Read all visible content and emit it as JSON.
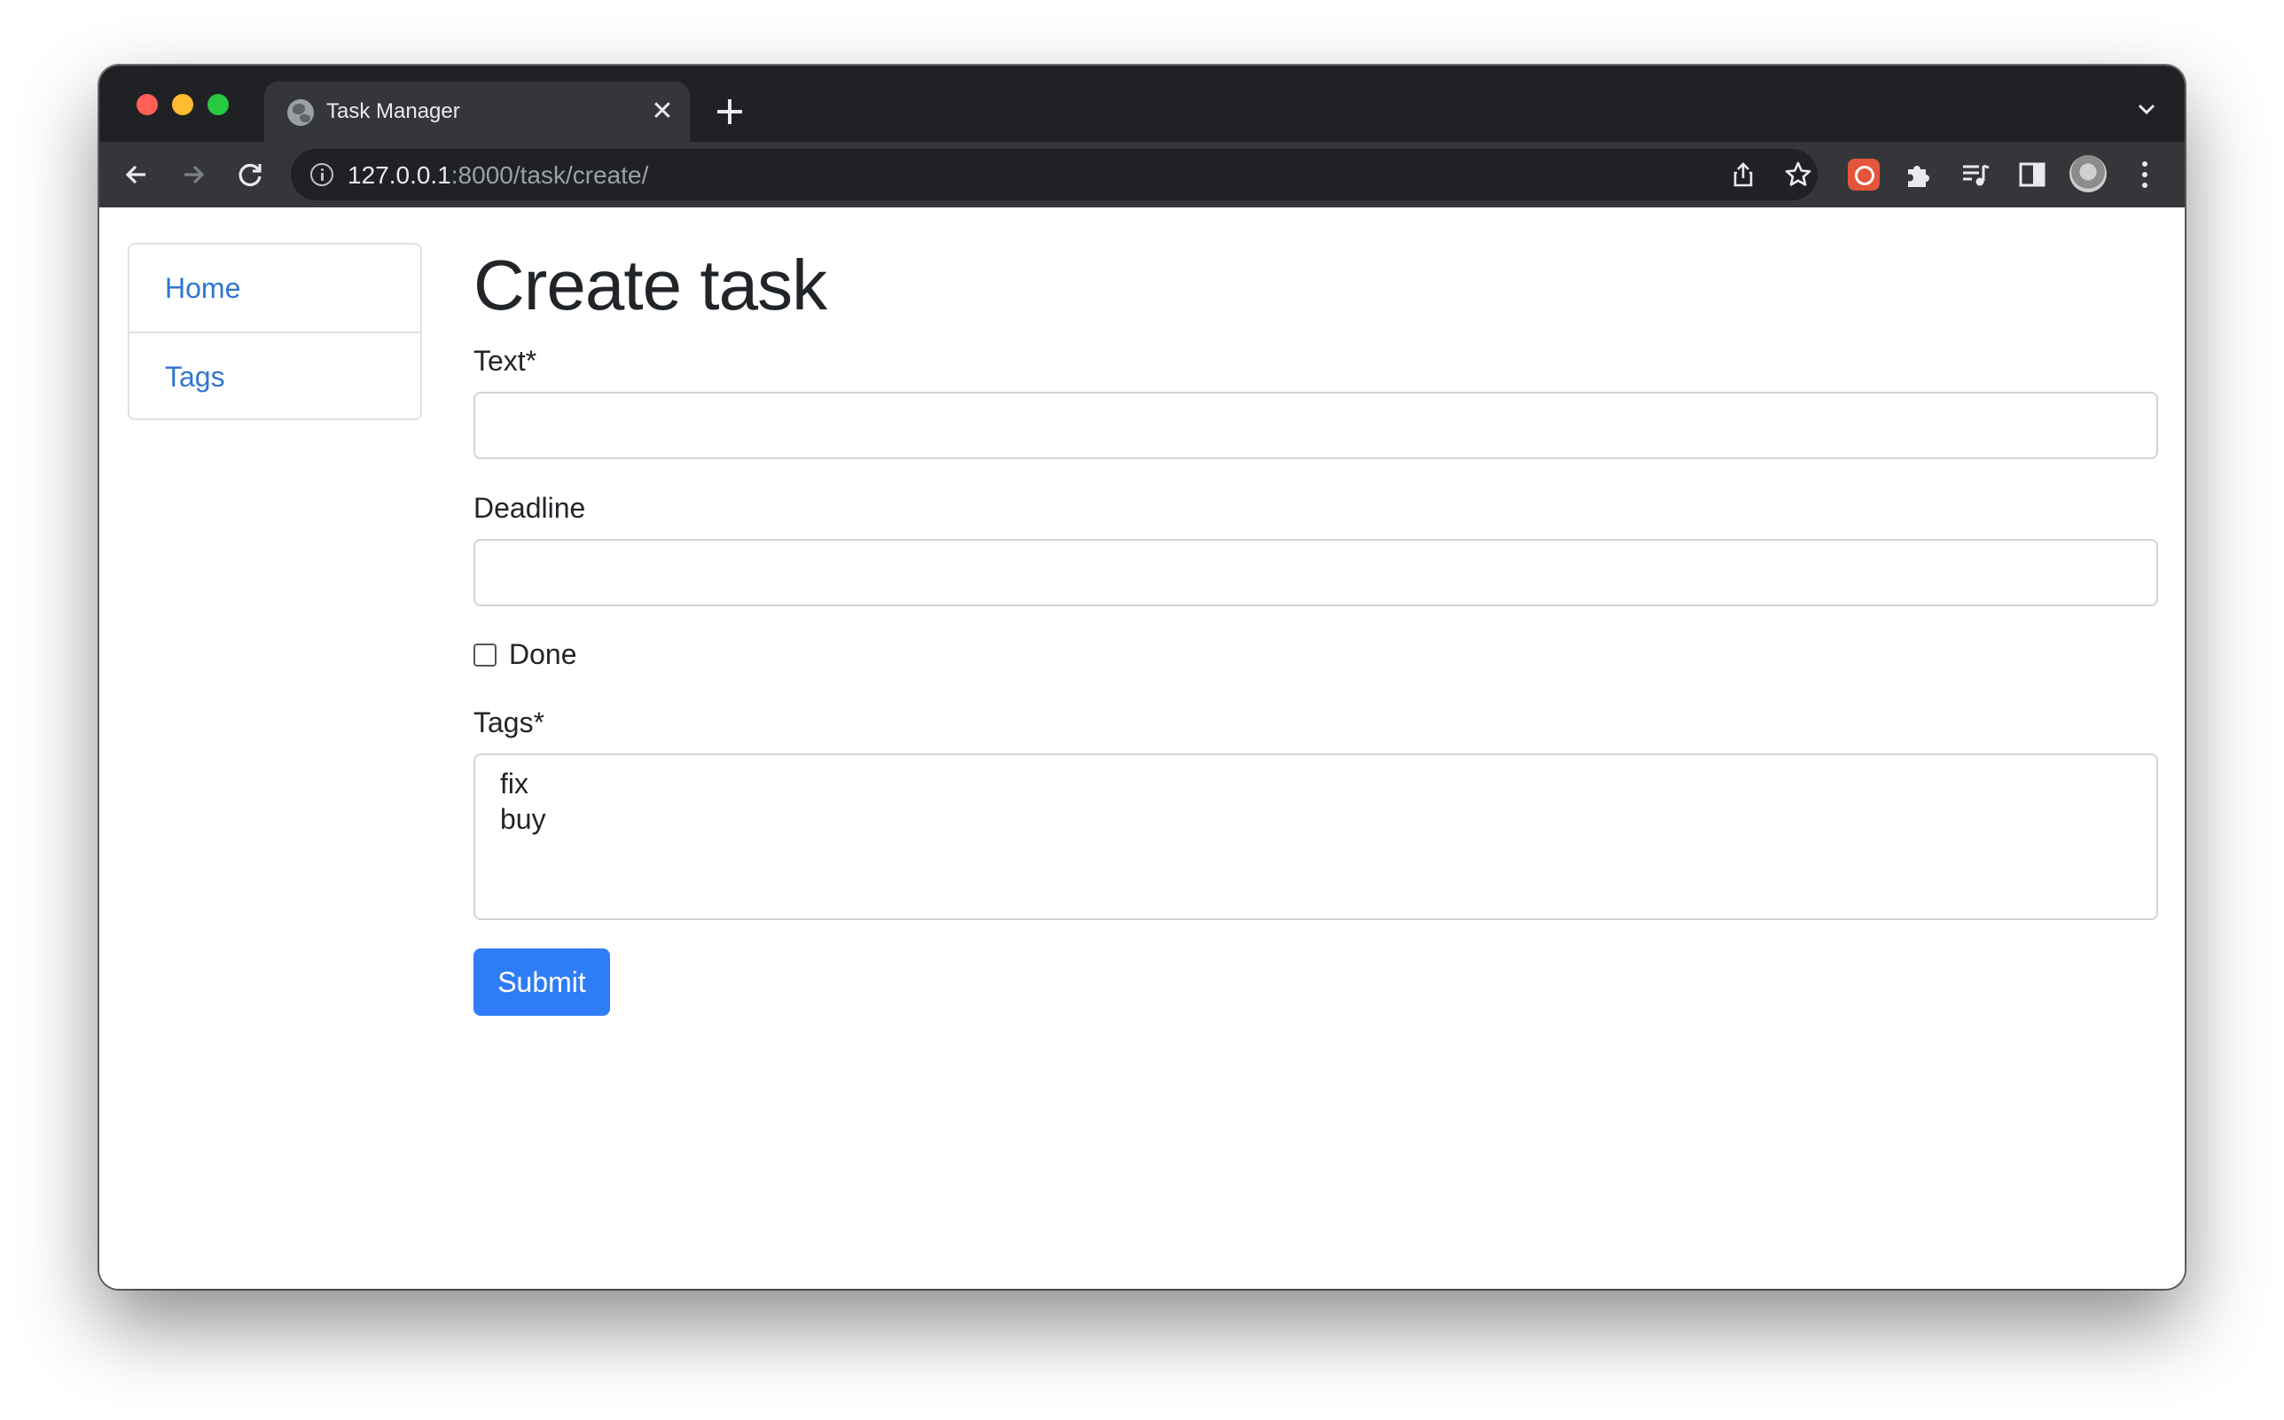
{
  "browser": {
    "tab_title": "Task Manager",
    "tab_close": "✕",
    "url_host": "127.0.0.1",
    "url_rest": ":8000/task/create/"
  },
  "sidebar": {
    "items": [
      {
        "label": "Home"
      },
      {
        "label": "Tags"
      }
    ]
  },
  "form": {
    "title": "Create task",
    "text_label": "Text*",
    "text_value": "",
    "deadline_label": "Deadline",
    "deadline_value": "",
    "done_label": "Done",
    "done_checked": false,
    "tags_label": "Tags*",
    "tags_options": [
      "fix",
      "buy"
    ],
    "submit_label": "Submit"
  },
  "colors": {
    "link": "#2f76d2",
    "primary_button": "#2f7df6",
    "tab_bar": "#202124",
    "toolbar": "#35363a"
  }
}
